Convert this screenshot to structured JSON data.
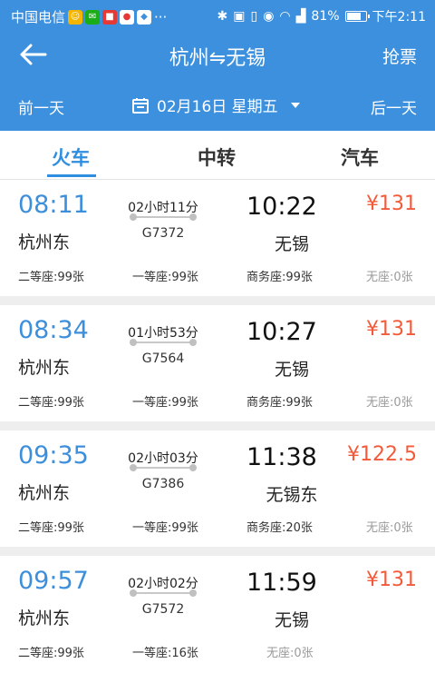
{
  "status_bar": {
    "carrier": "中国电信",
    "more": "···",
    "battery_text": "81%",
    "battery_level": 0.81,
    "time": "下午2:11"
  },
  "header": {
    "title": "杭州⇋无锡",
    "grab_ticket": "抢票"
  },
  "datebar": {
    "prev_day": "前一天",
    "date": "02月16日 星期五",
    "next_day": "后一天"
  },
  "tabs": [
    "火车",
    "中转",
    "汽车"
  ],
  "trains": [
    {
      "dep_time": "08:11",
      "dep_station": "杭州东",
      "duration": "02小时11分",
      "train_no": "G7372",
      "arr_time": "10:22",
      "arr_station": "无锡",
      "price": "¥131",
      "seats": [
        "二等座:99张",
        "一等座:99张",
        "商务座:99张",
        "无座:0张"
      ]
    },
    {
      "dep_time": "08:34",
      "dep_station": "杭州东",
      "duration": "01小时53分",
      "train_no": "G7564",
      "arr_time": "10:27",
      "arr_station": "无锡",
      "price": "¥131",
      "seats": [
        "二等座:99张",
        "一等座:99张",
        "商务座:99张",
        "无座:0张"
      ]
    },
    {
      "dep_time": "09:35",
      "dep_station": "杭州东",
      "duration": "02小时03分",
      "train_no": "G7386",
      "arr_time": "11:38",
      "arr_station": "无锡东",
      "price": "¥122.5",
      "seats": [
        "二等座:99张",
        "一等座:99张",
        "商务座:20张",
        "无座:0张"
      ]
    },
    {
      "dep_time": "09:57",
      "dep_station": "杭州东",
      "duration": "02小时02分",
      "train_no": "G7572",
      "arr_time": "11:59",
      "arr_station": "无锡",
      "price": "¥131",
      "seats": [
        "二等座:99张",
        "一等座:16张",
        "无座:0张"
      ]
    }
  ]
}
